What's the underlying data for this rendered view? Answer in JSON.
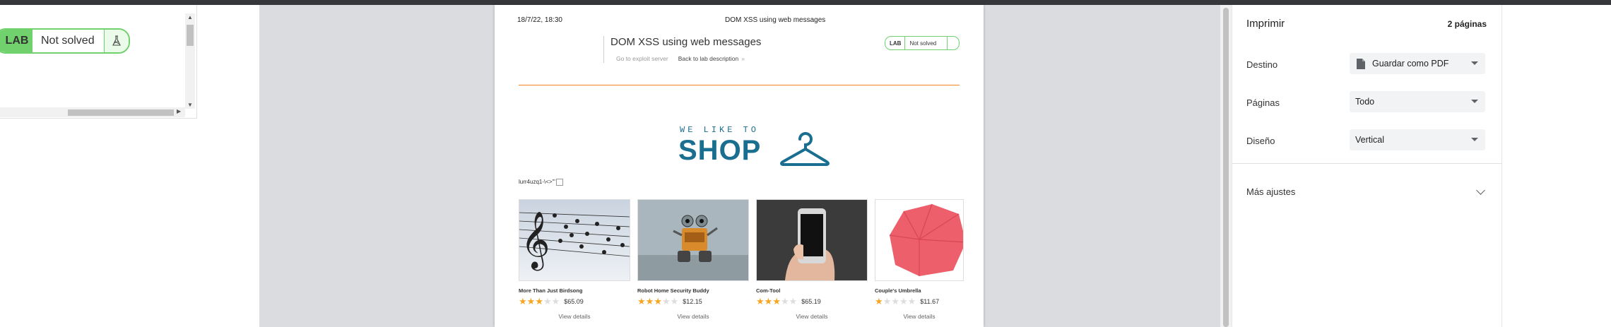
{
  "left_frame": {
    "lab_tag": "LAB",
    "lab_status": "Not solved"
  },
  "print_page": {
    "header_date": "18/7/22, 18:30",
    "header_title": "DOM XSS using web messages",
    "lab_title": "DOM XSS using web messages",
    "go_to_exploit": "Go to exploit server",
    "back_to_lab": "Back to lab description",
    "back_chevron": "»",
    "mini_lab_tag": "LAB",
    "mini_lab_status": "Not solved",
    "logo_top": "WE LIKE TO",
    "logo_main": "SHOP",
    "injected_text": "lurr4uzq1-\\<>\"'",
    "products": [
      {
        "name": "More Than Just Birdsong",
        "rating": 3,
        "price": "$65.09",
        "view": "View details"
      },
      {
        "name": "Robot Home Security Buddy",
        "rating": 3,
        "price": "$12.15",
        "view": "View details"
      },
      {
        "name": "Com-Tool",
        "rating": 3,
        "price": "$65.19",
        "view": "View details"
      },
      {
        "name": "Couple's Umbrella",
        "rating": 1,
        "price": "$11.67",
        "view": "View details"
      }
    ]
  },
  "print_panel": {
    "title": "Imprimir",
    "pages": "2 páginas",
    "destino_label": "Destino",
    "destino_value": "Guardar como PDF",
    "paginas_label": "Páginas",
    "paginas_value": "Todo",
    "diseno_label": "Diseño",
    "diseno_value": "Vertical",
    "mas_ajustes": "Más ajustes"
  },
  "colors": {
    "lab_green": "#70d16d",
    "shop_blue": "#1a6e8f",
    "rule_orange": "#f58220",
    "star_gold": "#f5a623"
  }
}
